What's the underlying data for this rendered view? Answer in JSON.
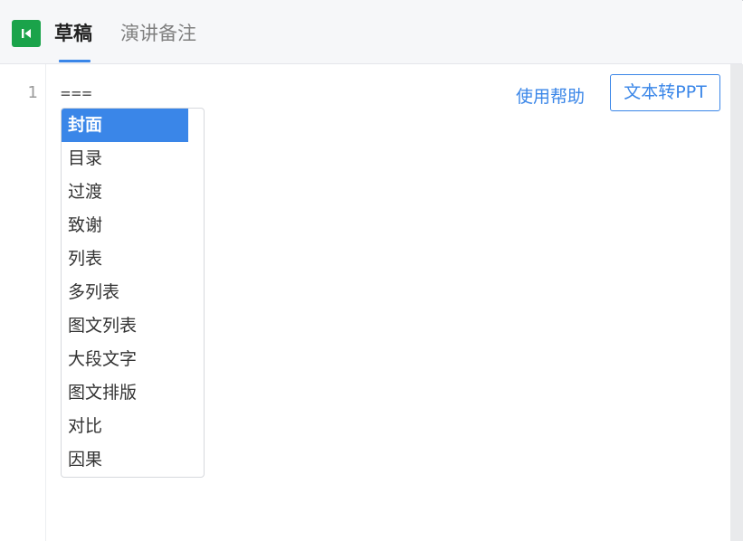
{
  "header": {
    "tabs": [
      {
        "label": "草稿",
        "active": true
      },
      {
        "label": "演讲备注",
        "active": false
      }
    ],
    "collapse_icon": "skip-back-icon"
  },
  "editor": {
    "line_number": "1",
    "line_text": "===",
    "help_link": "使用帮助",
    "convert_button": "文本转PPT"
  },
  "dropdown": {
    "selected": "封面",
    "items": [
      "封面",
      "目录",
      "过渡",
      "致谢",
      "列表",
      "多列表",
      "图文列表",
      "大段文字",
      "图文排版",
      "对比",
      "因果"
    ]
  },
  "colors": {
    "accent": "#3a86e8",
    "brand_green": "#1aa34a"
  }
}
